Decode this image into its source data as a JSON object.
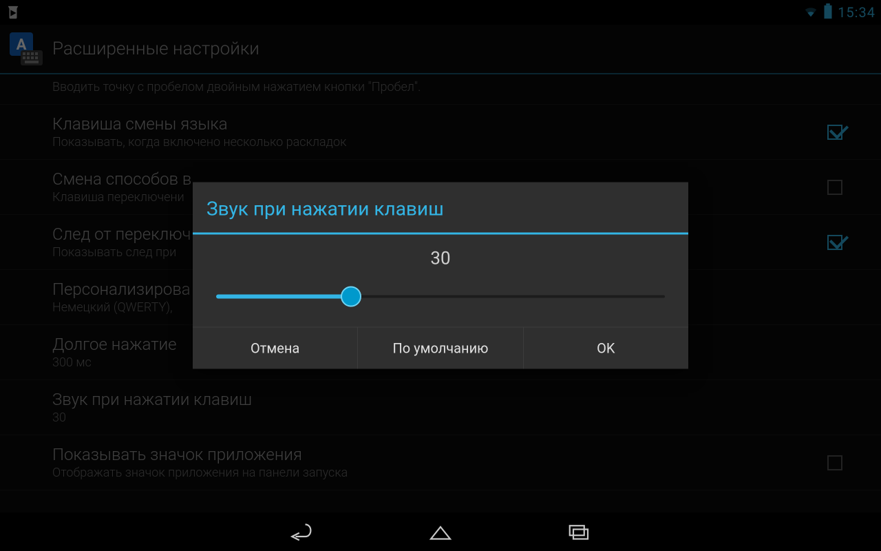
{
  "status": {
    "time": "15:34"
  },
  "appbar": {
    "title": "Расширенные настройки"
  },
  "list": {
    "items": [
      {
        "title": "",
        "sub": "Вводить точку с пробелом двойным нажатием кнопки \"Пробел\".",
        "checkbox": null
      },
      {
        "title": "Клавиша смены языка",
        "sub": "Показывать, когда включено несколько раскладок",
        "checkbox": true
      },
      {
        "title": "Смена способов в",
        "sub": "Клавиша переключени",
        "checkbox": false
      },
      {
        "title": "След от переключ",
        "sub": "Показывать след при",
        "checkbox": true
      },
      {
        "title": "Персонализирова",
        "sub": "Немецкий (QWERTY),",
        "checkbox": null
      },
      {
        "title": "Долгое нажатие",
        "sub": "300 мс",
        "checkbox": null
      },
      {
        "title": "Звук при нажатии клавиш",
        "sub": "30",
        "checkbox": null
      },
      {
        "title": "Показывать значок приложения",
        "sub": "Отображать значок приложения на панели запуска",
        "checkbox": false
      }
    ]
  },
  "dialog": {
    "title": "Звук при нажатии клавиш",
    "value": "30",
    "slider_percent": 30,
    "buttons": {
      "cancel": "Отмена",
      "default": "По умолчанию",
      "ok": "OK"
    }
  }
}
